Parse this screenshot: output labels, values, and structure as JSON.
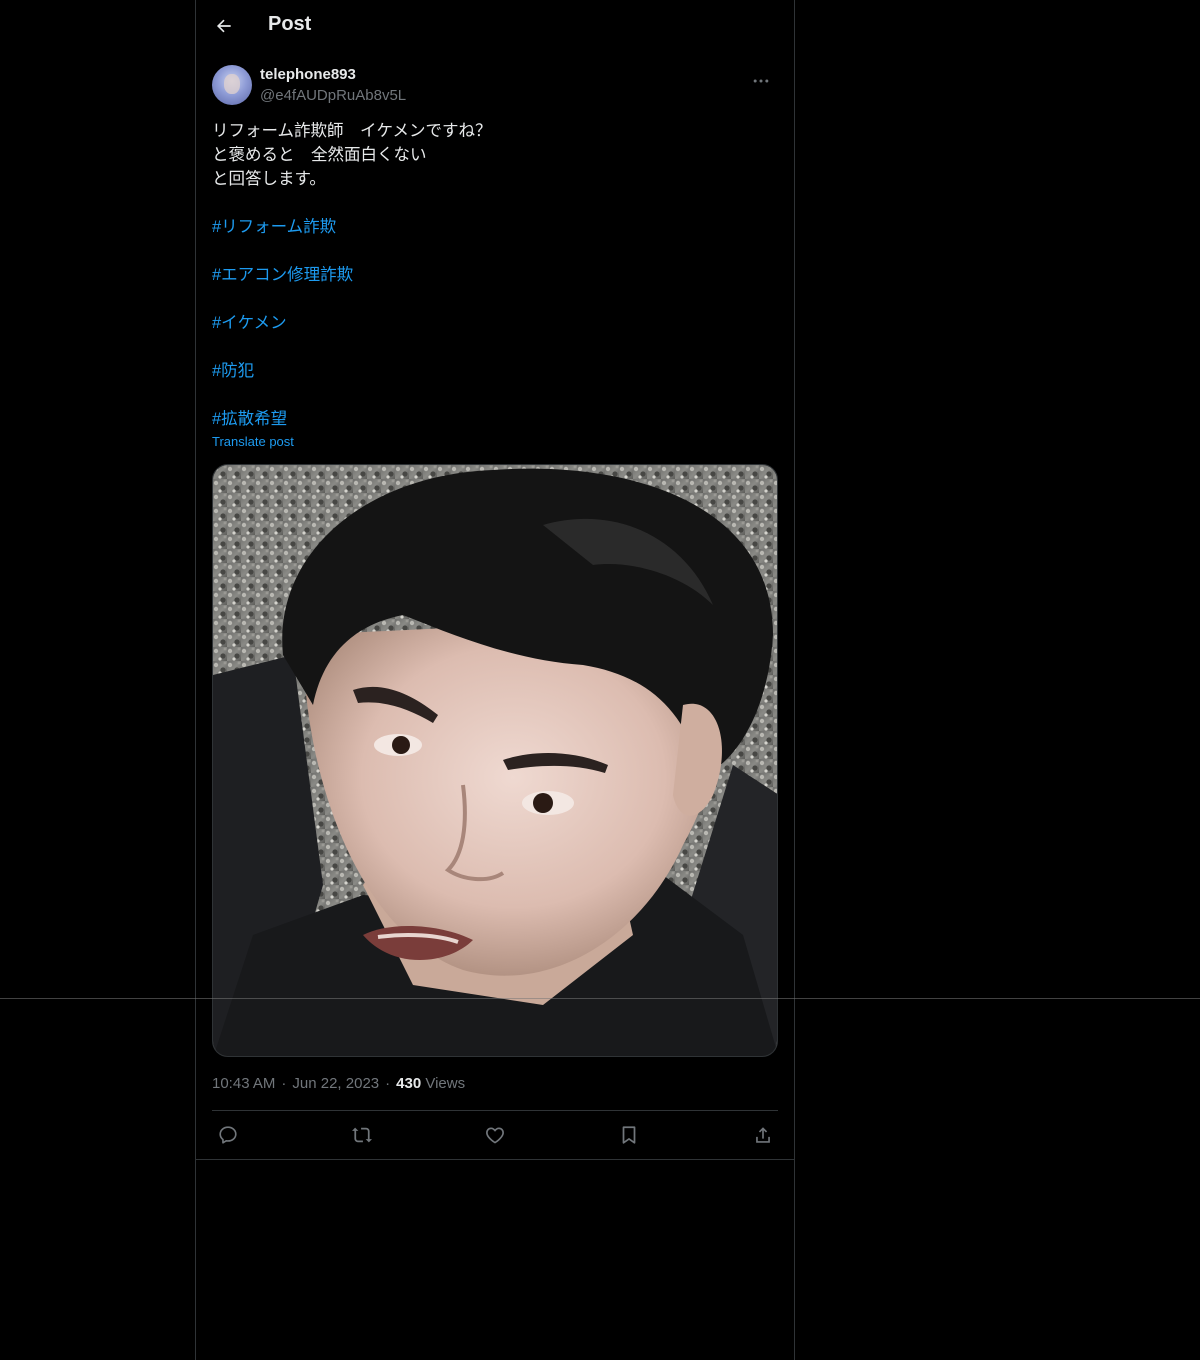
{
  "header": {
    "back_icon": "arrow-left-icon",
    "title": "Post"
  },
  "author": {
    "display_name": "telephone893",
    "handle": "@e4fAUDpRuAb8v5L",
    "more_icon": "more-horizontal-icon"
  },
  "post": {
    "lines": [
      "リフォーム詐欺師　イケメンですね？",
      "と褒めると　全然面白くない",
      "と回答します。"
    ],
    "hashtags": [
      "#リフォーム詐欺",
      "#エアコン修理詐欺",
      "#イケメン",
      "#防犯",
      "#拡散希望"
    ],
    "translate_label": "Translate post"
  },
  "meta": {
    "time": "10:43 AM",
    "separator": "·",
    "date": "Jun 22, 2023",
    "views_count": "430",
    "views_label": "Views"
  },
  "actions": [
    {
      "icon": "reply-icon"
    },
    {
      "icon": "repost-icon"
    },
    {
      "icon": "like-icon"
    },
    {
      "icon": "bookmark-icon"
    },
    {
      "icon": "share-icon"
    }
  ],
  "colors": {
    "background": "#000000",
    "text": "#e7e9ea",
    "secondary_text": "#71767b",
    "link": "#1d9bf0",
    "border": "#2f3336"
  }
}
